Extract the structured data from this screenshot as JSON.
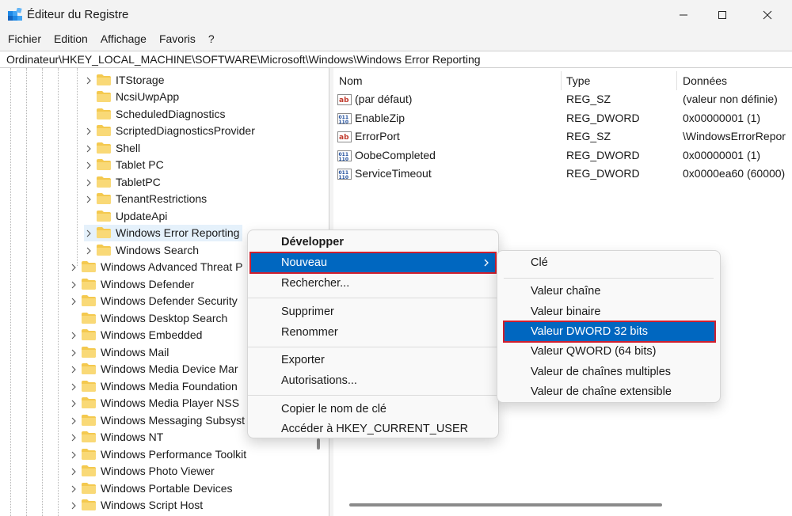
{
  "window": {
    "title": "Éditeur du Registre",
    "controls": [
      "minimize-icon",
      "maximize-icon",
      "close-icon"
    ]
  },
  "menubar": [
    "Fichier",
    "Edition",
    "Affichage",
    "Favoris",
    "?"
  ],
  "address": "Ordinateur\\HKEY_LOCAL_MACHINE\\SOFTWARE\\Microsoft\\Windows\\Windows Error Reporting",
  "tree": {
    "children": [
      "ITStorage",
      "NcsiUwpApp",
      "ScheduledDiagnostics",
      "ScriptedDiagnosticsProvider",
      "Shell",
      "Tablet PC",
      "TabletPC",
      "TenantRestrictions",
      "UpdateApi",
      "Windows Error Reporting",
      "Windows Search"
    ],
    "siblings": [
      "Windows Advanced Threat P",
      "Windows Defender",
      "Windows Defender Security",
      "Windows Desktop Search",
      "Windows Embedded",
      "Windows Mail",
      "Windows Media Device Mar",
      "Windows Media Foundation",
      "Windows Media Player NSS",
      "Windows Messaging Subsyst",
      "Windows NT",
      "Windows Performance Toolkit",
      "Windows Photo Viewer",
      "Windows Portable Devices",
      "Windows Script Host"
    ]
  },
  "list": {
    "headers": {
      "name": "Nom",
      "type": "Type",
      "data": "Données"
    },
    "rows": [
      {
        "icon": "string-value-icon",
        "name": "(par défaut)",
        "type": "REG_SZ",
        "data": "(valeur non définie)"
      },
      {
        "icon": "binary-value-icon",
        "name": "EnableZip",
        "type": "REG_DWORD",
        "data": "0x00000001 (1)"
      },
      {
        "icon": "string-value-icon",
        "name": "ErrorPort",
        "type": "REG_SZ",
        "data": "\\WindowsErrorRepor"
      },
      {
        "icon": "binary-value-icon",
        "name": "OobeCompleted",
        "type": "REG_DWORD",
        "data": "0x00000001 (1)"
      },
      {
        "icon": "binary-value-icon",
        "name": "ServiceTimeout",
        "type": "REG_DWORD",
        "data": "0x0000ea60 (60000)"
      }
    ]
  },
  "context_menu": {
    "expand": "Développer",
    "new": "Nouveau",
    "find": "Rechercher...",
    "delete": "Supprimer",
    "rename": "Renommer",
    "export": "Exporter",
    "permissions": "Autorisations...",
    "copy_key": "Copier le nom de clé",
    "goto": "Accéder à HKEY_CURRENT_USER"
  },
  "submenu": {
    "key": "Clé",
    "string": "Valeur chaîne",
    "binary": "Valeur binaire",
    "dword": "Valeur DWORD 32 bits",
    "qword": "Valeur QWORD (64 bits)",
    "multi": "Valeur de chaînes multiples",
    "expand": "Valeur de chaîne extensible"
  },
  "colors": {
    "highlight": "#0067c0",
    "highlight_border": "#d01f2e",
    "folder": "#f4c94f"
  }
}
